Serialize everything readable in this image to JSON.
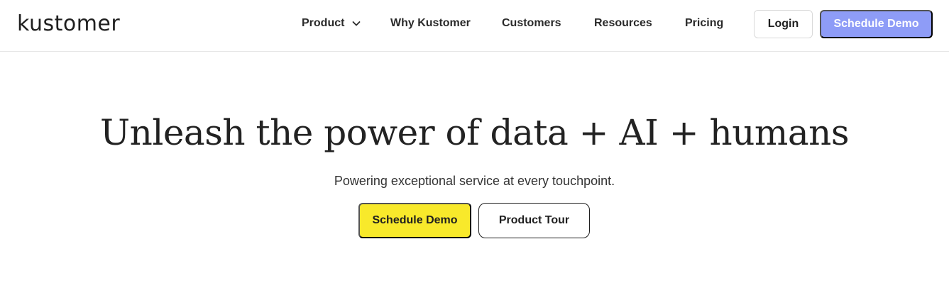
{
  "brand": {
    "logo_text": "kustomer"
  },
  "nav": {
    "items": [
      {
        "label": "Product",
        "has_dropdown": true
      },
      {
        "label": "Why Kustomer"
      },
      {
        "label": "Customers"
      },
      {
        "label": "Resources"
      },
      {
        "label": "Pricing"
      }
    ],
    "login_label": "Login",
    "demo_label": "Schedule Demo"
  },
  "hero": {
    "title": "Unleash the power of data + AI + humans",
    "subtitle": "Powering exceptional service at every touchpoint.",
    "primary_cta": "Schedule Demo",
    "secondary_cta": "Product Tour"
  },
  "colors": {
    "nav_demo_button": "#8e9cf7",
    "hero_demo_button": "#f8e92b",
    "text": "#1f1f1f"
  },
  "icons": {
    "product_dropdown": "chevron-down-icon"
  }
}
